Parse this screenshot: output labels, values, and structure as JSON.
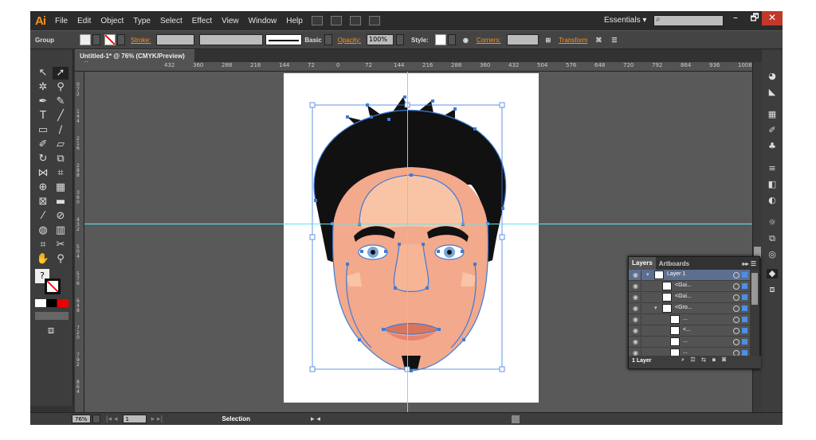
{
  "app": {
    "logo": "Ai"
  },
  "menu": [
    "File",
    "Edit",
    "Object",
    "Type",
    "Select",
    "Effect",
    "View",
    "Window",
    "Help"
  ],
  "workspace": {
    "label": "Essentials",
    "chevron": "▾",
    "search_icon": "⌕"
  },
  "window_controls": [
    "–",
    "🗗",
    "✕"
  ],
  "control_bar": {
    "selection_label": "Group",
    "stroke_label": "Stroke:",
    "brush_label": "Basic",
    "opacity_label": "Opacity:",
    "opacity_value": "100%",
    "style_label": "Style:",
    "corners_label": "Corners:",
    "transform_label": "Transform"
  },
  "document_tab": {
    "title": "Untitled-1* @ 76% (CMYK/Preview)",
    "close": "×"
  },
  "ruler_h": [
    "432",
    "360",
    "288",
    "216",
    "144",
    "72",
    "0",
    "72",
    "144",
    "216",
    "288",
    "360",
    "432",
    "504",
    "576",
    "648",
    "720",
    "792",
    "864",
    "936",
    "1008",
    "1080"
  ],
  "ruler_v": [
    "0\n7\n2",
    "1\n4\n4",
    "2\n1\n6",
    "2\n8\n8",
    "3\n6\n0",
    "4\n3\n2",
    "5\n0\n4",
    "5\n7\n6",
    "6\n4\n8",
    "7\n2\n0",
    "7\n9\n2",
    "8\n6\n4"
  ],
  "status": {
    "zoom": "76%",
    "page": "1",
    "mode": "Selection"
  },
  "layers_panel": {
    "tabs": [
      "Layers",
      "Artboards"
    ],
    "footer": "1 Layer",
    "rows": [
      {
        "name": "Layer 1",
        "indent": 0
      },
      {
        "name": "<Gui...",
        "indent": 1
      },
      {
        "name": "<Gui...",
        "indent": 1
      },
      {
        "name": "<Gro...",
        "indent": 1
      },
      {
        "name": "...",
        "indent": 2
      },
      {
        "name": "<...",
        "indent": 2
      },
      {
        "name": "...",
        "indent": 2
      },
      {
        "name": "...",
        "indent": 2
      }
    ]
  },
  "colors": {
    "accent": "#f7931e",
    "guide": "#5de8f5",
    "path": "#3d7bd9",
    "skin": "#f3a98c",
    "hair": "#111111"
  }
}
